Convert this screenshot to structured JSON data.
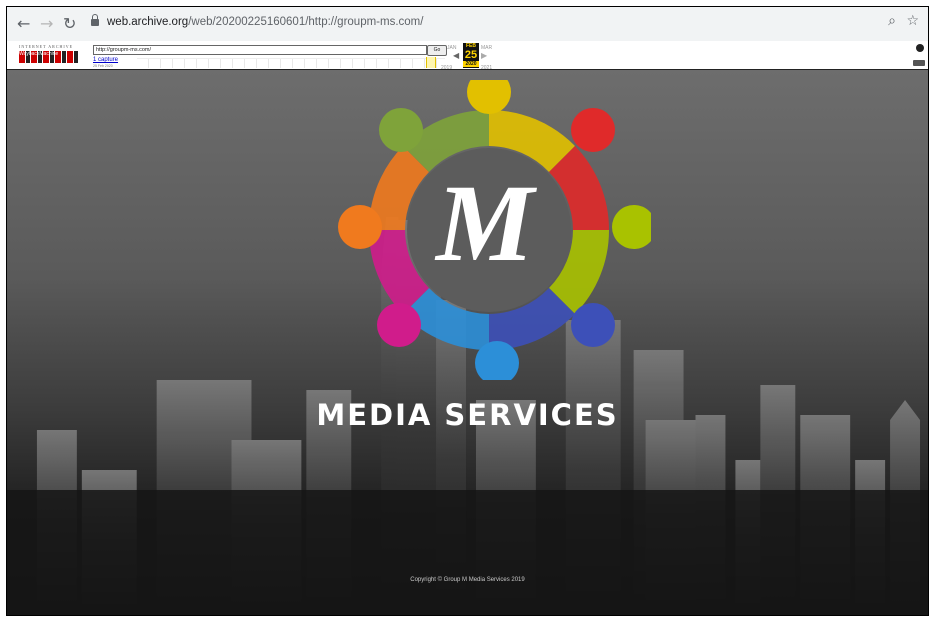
{
  "browser": {
    "url_host": "web.archive.org",
    "url_path": "/web/20200225160601/http://groupm-ms.com/"
  },
  "wayback": {
    "logo_top": "INTERNET ARCHIVE",
    "logo_main": "WaybackMachine",
    "url_input": "http://groupm-ms.com/",
    "go_label": "Go",
    "captures_link": "1 capture",
    "captures_date": "25 Feb 2020",
    "prev_month": "JAN",
    "current_month": "FEB",
    "next_month": "MAR",
    "current_day": "25",
    "prev_year": "2019",
    "current_year": "2020",
    "next_year": "2021"
  },
  "hero": {
    "logo_letter": "M",
    "title": "MEDIA SERVICES",
    "copyright": "Copyright © Group M Media Services 2019"
  },
  "colors": {
    "wayback_highlight": "#ffd400",
    "logo_people": [
      "#e2c000",
      "#e02a2a",
      "#a9c200",
      "#3d50b8",
      "#2c8fd8",
      "#d01c8b",
      "#f07a1e",
      "#7fa33a"
    ]
  },
  "icons": [
    "back-arrow-icon",
    "forward-arrow-icon",
    "reload-icon",
    "lock-icon",
    "zoom-icon",
    "star-icon"
  ]
}
